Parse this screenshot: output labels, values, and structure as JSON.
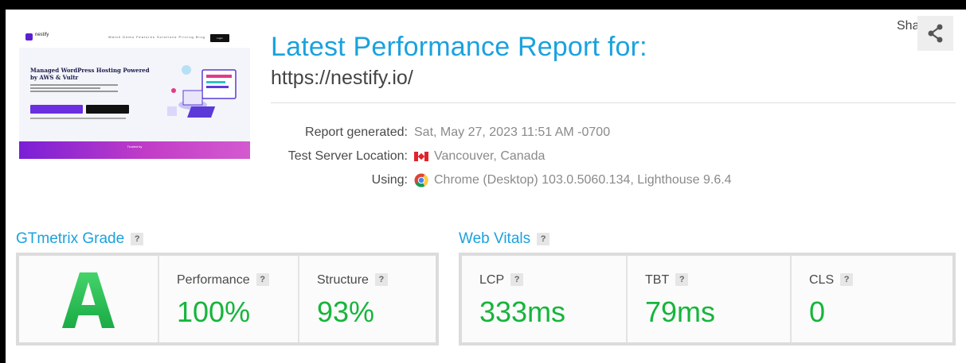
{
  "thumbnail": {
    "logo": "nestify",
    "nav_links": "Watch Demo   Features   Solutions   Pricing   Blog",
    "login": "Login",
    "headline": "Managed WordPress Hosting Powered by AWS & Vultr",
    "band_text": "Trusted by"
  },
  "header": {
    "title": "Latest Performance Report for:",
    "url": "https://nestify.io/",
    "share_label": "Share"
  },
  "meta": {
    "report_generated_label": "Report generated:",
    "report_generated_value": "Sat, May 27, 2023 11:51 AM -0700",
    "location_label": "Test Server Location:",
    "location_value": "Vancouver, Canada",
    "using_label": "Using:",
    "using_value": "Chrome (Desktop) 103.0.5060.134, Lighthouse 9.6.4"
  },
  "grade_section": {
    "title": "GTmetrix Grade",
    "help": "?",
    "grade": "A",
    "performance_label": "Performance",
    "performance_value": "100%",
    "structure_label": "Structure",
    "structure_value": "93%"
  },
  "vitals_section": {
    "title": "Web Vitals",
    "help": "?",
    "lcp_label": "LCP",
    "lcp_value": "333ms",
    "tbt_label": "TBT",
    "tbt_value": "79ms",
    "cls_label": "CLS",
    "cls_value": "0"
  },
  "colors": {
    "title_blue": "#1aa2de",
    "metric_green": "#16b53b",
    "grade_green": "#2fc25a"
  },
  "icons": [
    "share-icon",
    "canada-flag-icon",
    "chrome-icon",
    "help-icon"
  ]
}
